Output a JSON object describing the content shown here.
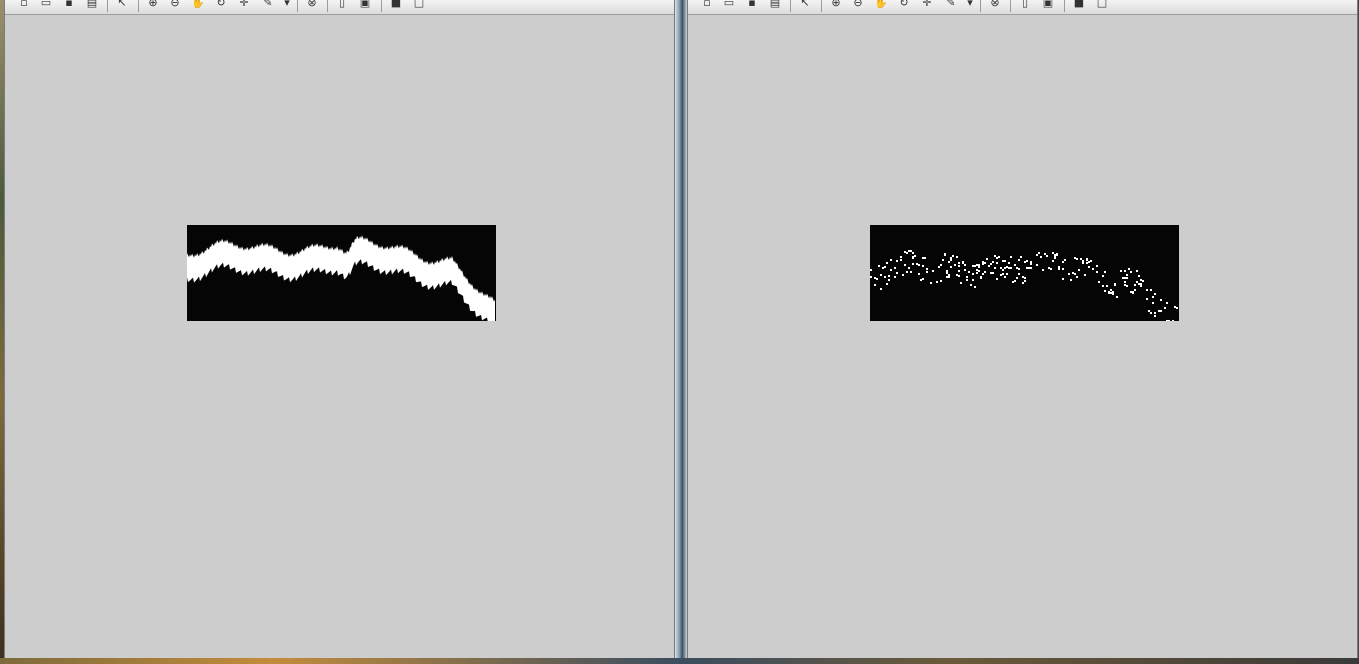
{
  "toolbar": {
    "buttons": [
      {
        "name": "new-figure-icon",
        "glyph": "▫"
      },
      {
        "name": "open-file-icon",
        "glyph": "▭"
      },
      {
        "name": "save-figure-icon",
        "glyph": "▪"
      },
      {
        "name": "print-figure-icon",
        "glyph": "▤"
      },
      {
        "name": "edit-plot-arrow-icon",
        "glyph": "↖"
      },
      {
        "name": "zoom-in-icon",
        "glyph": "⊕"
      },
      {
        "name": "zoom-out-icon",
        "glyph": "⊖"
      },
      {
        "name": "pan-hand-icon",
        "glyph": "✋"
      },
      {
        "name": "rotate-3d-icon",
        "glyph": "↻"
      },
      {
        "name": "data-cursor-icon",
        "glyph": "✛"
      },
      {
        "name": "brush-icon",
        "glyph": "✎"
      },
      {
        "name": "brush-dropdown-icon",
        "glyph": "▾"
      },
      {
        "name": "link-plot-icon",
        "glyph": "⊗"
      },
      {
        "name": "insert-colorbar-icon",
        "glyph": "▯"
      },
      {
        "name": "insert-legend-icon",
        "glyph": "▣"
      },
      {
        "name": "hide-plot-tools-icon",
        "glyph": "■"
      },
      {
        "name": "show-plot-tools-icon",
        "glyph": "□"
      }
    ]
  },
  "colors": {
    "figure_background": "#cdcdcd",
    "image_background": "#050505",
    "image_foreground": "#ffffff"
  },
  "images": [
    {
      "name": "left-binary-image",
      "style": "solid-band"
    },
    {
      "name": "right-binary-image",
      "style": "sparse-points"
    }
  ]
}
